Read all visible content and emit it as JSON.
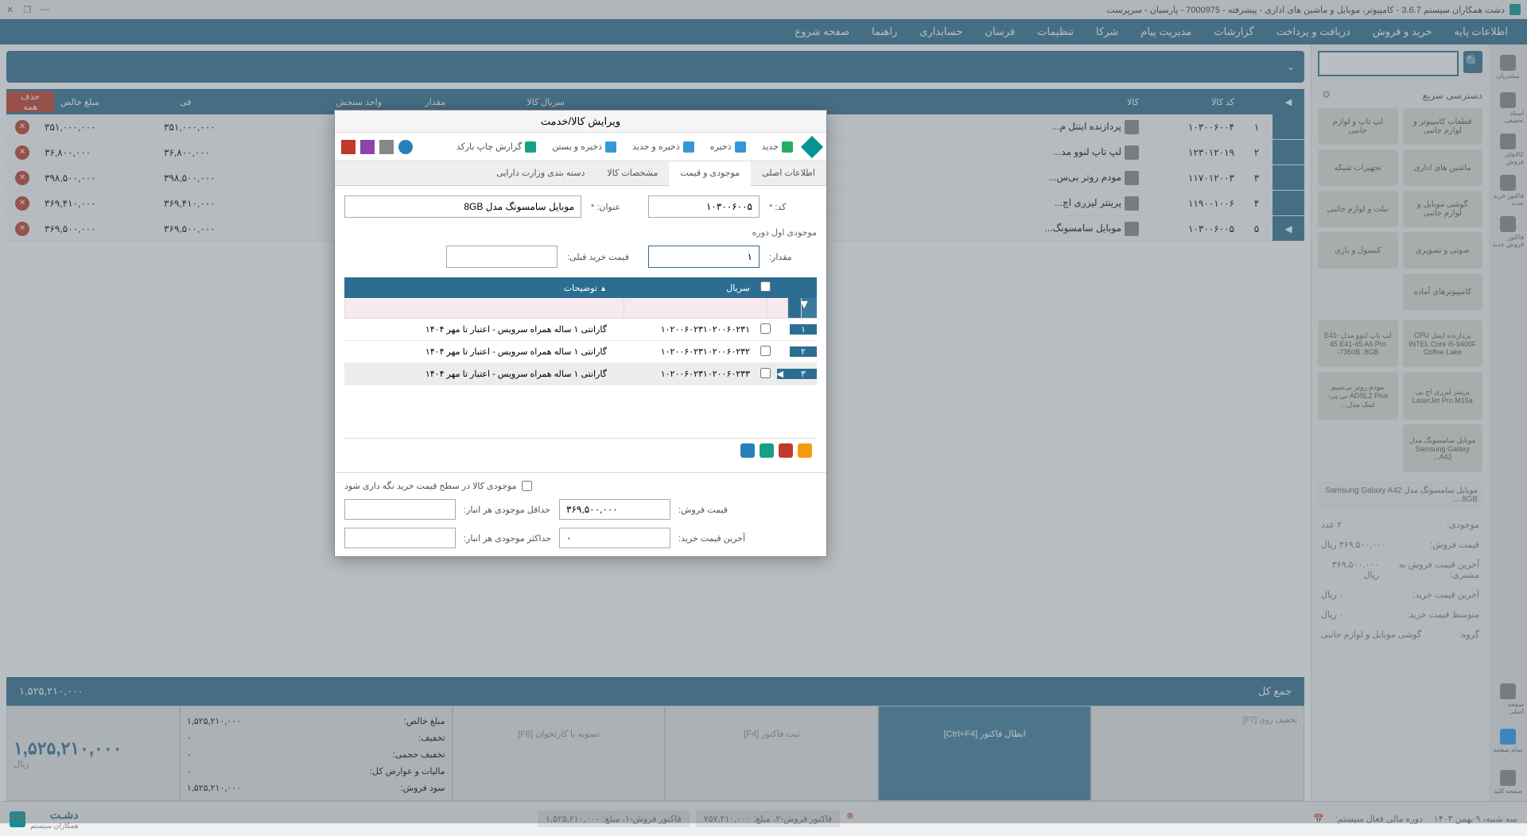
{
  "window": {
    "title": "دشت همکاران سیستم 3.6.7 - کامپیوتر، موبایل و ماشین های اداری - پیشرفته - 7000975 - پارسیان - سرپرست"
  },
  "menu": [
    "اطلاعات پایه",
    "خرید و فروش",
    "دریافت و پرداخت",
    "گزارشات",
    "مدیریت پیام",
    "شرکا",
    "تنظیمات",
    "فرسان",
    "حسابداری",
    "راهنما",
    "صفحه شروع"
  ],
  "right_toolbar": [
    "مشتریان",
    "اسناد تخفیفی",
    "کالاهای فروش",
    "فاکتور خرید جدید",
    "فاکتور فروش جدید",
    "صفحه اصلی",
    "تمام صفحه",
    "صفحه کلید"
  ],
  "quick": {
    "title": "دسترسی سریع",
    "search_placeholder": "",
    "categories": [
      "قطعات کامپیوتر و لوازم جانبی",
      "لپ تاپ و لوازم جانبی",
      "ماشین های اداری",
      "تجهیزات شبکه",
      "گوشی موبایل و لوازم جانبی",
      "تبلت و لوازم جانبی",
      "صوتی و تصویری",
      "کنسول و بازی",
      "کامپیوترهای آماده"
    ],
    "products": [
      "پردازنده اینتل CPU INTEL Core i5-9400F Coffee Lake",
      "لپ تاپ لنوو مدل E41-45 E41-45 A6 Pro -7350B .8GB",
      "پرینتر لیزری اچ پی LaserJet Pro M15a",
      "مودم روتر بی‌سیم ADSL2 Plus تی‌ پی-لینک مدل...",
      "موبایل سامسونگ مدل Samsung Galaxy A42..."
    ],
    "info": {
      "stock_label": "موجودی:",
      "stock_value": "۲ عدد",
      "sale_price_label": "قیمت فروش:",
      "sale_price_value": "۳۶۹,۵۰۰,۰۰۰ ریال",
      "last_sale_label": "آخرین قیمت فروش به مشتری:",
      "last_sale_value": "۳۶۹,۵۰۰,۰۰۰ ریال",
      "last_buy_label": "آخرین قیمت خرید:",
      "last_buy_value": "۰ ریال",
      "avg_buy_label": "متوسط قیمت خرید:",
      "avg_buy_value": "۰ ریال",
      "group_label": "گروه:",
      "group_value": "گوشی موبایل و لوازم جانبی"
    },
    "product_title": "موبایل سامسونگ مدل Samsung Galaxy A42 .8GB..."
  },
  "table": {
    "headers": {
      "num": "",
      "code": "کد کالا",
      "title": "کالا",
      "serial": "سریال کالا",
      "qty": "مقدار",
      "unit": "واحد سنجش",
      "price": "فی",
      "net": "مبلغ خالص",
      "del_all": "حذف همه"
    },
    "rows": [
      {
        "num": "۱",
        "code": "۱۰۳۰۰۶۰۰۴",
        "title": "پردازنده اینتل م...",
        "price": "۳۵۱,۰۰۰,۰۰۰",
        "net": "۳۵۱,۰۰۰,۰۰۰"
      },
      {
        "num": "۲",
        "code": "۱۲۳۰۱۲۰۱۹",
        "title": "لپ تاپ لنوو مد...",
        "price": "۳۶,۸۰۰,۰۰۰",
        "net": "۳۶,۸۰۰,۰۰۰"
      },
      {
        "num": "۳",
        "code": "۱۱۷۰۱۲۰۰۳",
        "title": "مودم روتر بی‌س...",
        "price": "۳۹۸,۵۰۰,۰۰۰",
        "net": "۳۹۸,۵۰۰,۰۰۰"
      },
      {
        "num": "۴",
        "code": "۱۱۹۰۰۱۰۰۶",
        "title": "پرینتر لیزری اچ...",
        "price": "۳۶۹,۴۱۰,۰۰۰",
        "net": "۳۶۹,۴۱۰,۰۰۰"
      },
      {
        "num": "۵",
        "code": "۱۰۳۰۰۶۰۰۵",
        "title": "موبایل سامسونگ...",
        "price": "۳۶۹,۵۰۰,۰۰۰",
        "net": "۳۶۹,۵۰۰,۰۰۰"
      }
    ]
  },
  "summary": {
    "total_label": "جمع کل",
    "total_value": "۱,۵۲۵,۲۱۰,۰۰۰",
    "net_label": "مبلغ خالص:",
    "net_value": "۱,۵۲۵,۲۱۰,۰۰۰",
    "discount_label": "تخفیف:",
    "discount_value": "۰",
    "vol_discount_label": "تخفیف حجمی:",
    "vol_discount_value": "۰",
    "tax_label": "مالیات و عوارض کل:",
    "tax_value": "۰",
    "profit_label": "سود فروش:",
    "profit_value": "۱,۵۲۵,۲۱۰,۰۰۰",
    "big_total": "۱,۵۲۵,۲۱۰,۰۰۰",
    "currency": "ریال",
    "btn1": "تسویه با کارتخوان [F8]",
    "btn2": "ثبت فاکتور [F4]",
    "btn3": "ابطال فاکتور [Ctrl+F4]",
    "btn4": "تخفیف روی [F7]"
  },
  "status": {
    "date_label": "سه شنبه، ۹ بهمن ۱۴۰۳",
    "fiscal_label": "دوره مالی فعال سیستم:",
    "tag1": "فاکتور فروش-۲، مبلغ: ۷۵۷,۲۱۰,۰۰۰",
    "tag2": "فاکتور فروش-۱، مبلغ: ۱,۵۲۵,۲۱۰,۰۰۰",
    "brand": "دشـت",
    "brand_sub": "همکاران سیستم"
  },
  "modal": {
    "title": "ویرایش کالا/خدمت",
    "toolbar": {
      "new": "جدید",
      "save": "ذخیره",
      "save_new": "ذخیره و جدید",
      "save_close": "ذخیره و بستن",
      "barcode": "گزارش چاپ بارکد"
    },
    "tabs": [
      "اطلاعات اصلی",
      "موجودی و قیمت",
      "مشخصات کالا",
      "دسته بندی وزارت دارایی"
    ],
    "form": {
      "code_label": "کد:",
      "code_value": "۱۰۳۰۰۶۰۰۵",
      "title_label": "عنوان:",
      "title_value": "موبایل سامسونگ مدل 8GB",
      "section": "موجودی اول دوره",
      "qty_label": "مقدار:",
      "qty_value": "۱",
      "prev_price_label": "قیمت خرید قبلی:",
      "prev_price_value": ""
    },
    "grid": {
      "headers": {
        "serial": "سریال",
        "desc": "توضیحات"
      },
      "rows": [
        {
          "num": "۱",
          "serial": "۱۰۲۰۰۶۰۲۳۱۰۲۰۰۶۰۲۳۱",
          "desc": "گارانتی ۱ ساله همراه سرویس - اعتبار تا مهر ۱۴۰۴"
        },
        {
          "num": "۲",
          "serial": "۱۰۲۰۰۶۰۲۳۱۰۲۰۰۶۰۲۳۲",
          "desc": "گارانتی ۱ ساله همراه سرویس - اعتبار تا مهر ۱۴۰۴"
        },
        {
          "num": "۳",
          "serial": "۱۰۲۰۰۶۰۲۳۱۰۲۰۰۶۰۲۳۳",
          "desc": "گارانتی ۱ ساله همراه سرویس - اعتبار تا مهر ۱۴۰۴"
        }
      ]
    },
    "footer": {
      "checkbox": "موجودی کالا در سطح قیمت خرید نگه داری شود",
      "sale_price_label": "قیمت فروش:",
      "sale_price_value": "۳۶۹,۵۰۰,۰۰۰",
      "min_stock_label": "حداقل موجودی هر انبار:",
      "min_stock_value": "",
      "last_buy_label": "آخرین قیمت خرید:",
      "last_buy_value": "۰",
      "max_stock_label": "حداکثر موجودی هر انبار:",
      "max_stock_value": ""
    }
  }
}
